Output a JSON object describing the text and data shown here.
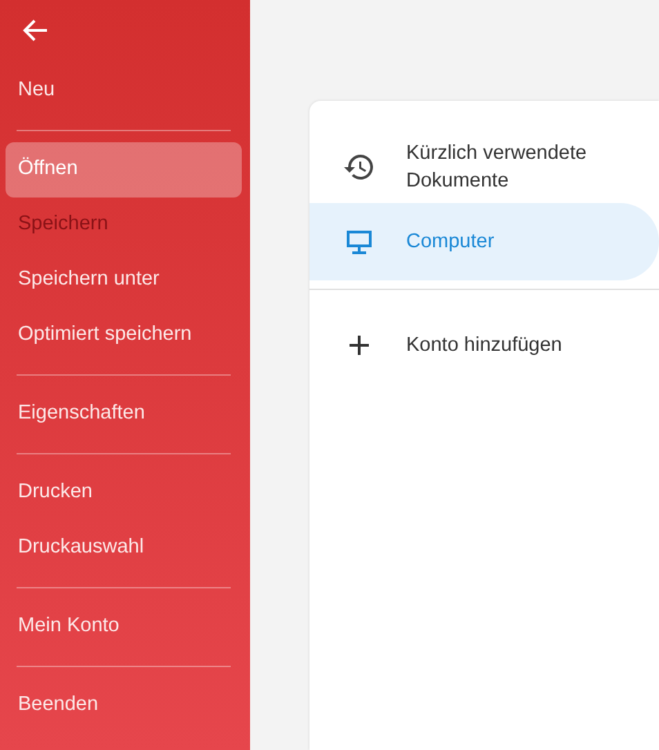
{
  "sidebar": {
    "groups": [
      {
        "items": [
          {
            "label": "Neu",
            "selected": false,
            "disabled": false
          }
        ]
      },
      {
        "items": [
          {
            "label": "Öffnen",
            "selected": true,
            "disabled": false
          },
          {
            "label": "Speichern",
            "selected": false,
            "disabled": true
          },
          {
            "label": "Speichern unter",
            "selected": false,
            "disabled": false
          },
          {
            "label": "Optimiert speichern",
            "selected": false,
            "disabled": false
          }
        ]
      },
      {
        "items": [
          {
            "label": "Eigenschaften",
            "selected": false,
            "disabled": false
          }
        ]
      },
      {
        "items": [
          {
            "label": "Drucken",
            "selected": false,
            "disabled": false
          },
          {
            "label": "Druckauswahl",
            "selected": false,
            "disabled": false
          }
        ]
      },
      {
        "items": [
          {
            "label": "Mein Konto",
            "selected": false,
            "disabled": false
          }
        ]
      },
      {
        "items": [
          {
            "label": "Beenden",
            "selected": false,
            "disabled": false
          }
        ]
      }
    ]
  },
  "locations": {
    "items": [
      {
        "kind": "recent",
        "label": "Kürzlich verwendete Dokumente",
        "selected": false
      },
      {
        "kind": "computer",
        "label": "Computer",
        "selected": true
      }
    ],
    "add_account": {
      "label": "Konto hinzufügen"
    }
  }
}
